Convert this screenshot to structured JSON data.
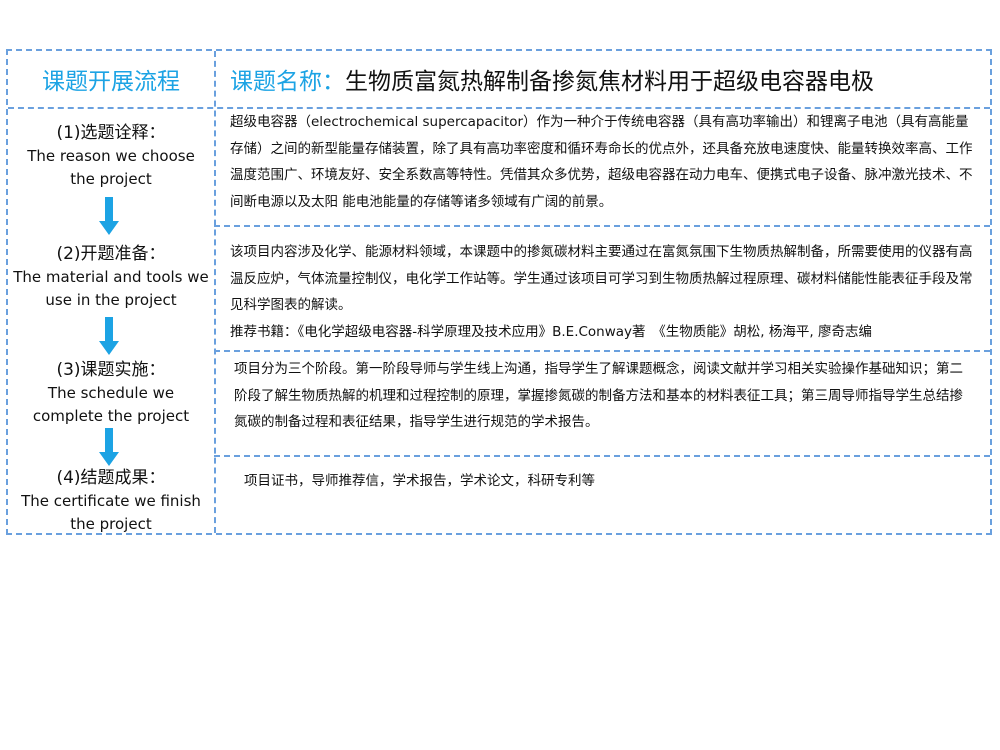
{
  "header": {
    "left_title": "课题开展流程",
    "right_label": "课题名称：",
    "right_title": "生物质富氮热解制备掺氮焦材料用于超级电容器电极"
  },
  "steps": [
    {
      "zh": "(1)选题诠释：",
      "en1": "The reason we choose",
      "en2": "the project"
    },
    {
      "zh": "(2)开题准备：",
      "en1": "The material and tools we",
      "en2": "use in the project"
    },
    {
      "zh": "(3)课题实施：",
      "en1": "The schedule we",
      "en2": "complete the project"
    },
    {
      "zh": "(4)结题成果：",
      "en1": "The certificate we finish",
      "en2": "the project"
    }
  ],
  "arrow_color": "#1ca3e4",
  "content": {
    "c1": "超级电容器（electrochemical supercapacitor）作为一种介于传统电容器（具有高功率输出）和锂离子电池（具有高能量存储）之间的新型能量存储装置，除了具有高功率密度和循环寿命长的优点外，还具备充放电速度快、能量转换效率高、工作温度范围广、环境友好、安全系数高等特性。凭借其众多优势，超级电容器在动力电车、便携式电子设备、脉冲激光技术、不间断电源以及太阳 能电池能量的存储等诸多领域有广阔的前景。",
    "c2": "该项目内容涉及化学、能源材料领域，本课题中的掺氮碳材料主要通过在富氮氛围下生物质热解制备，所需要使用的仪器有高温反应炉，气体流量控制仪，电化学工作站等。学生通过该项目可学习到生物质热解过程原理、碳材料储能性能表征手段及常见科学图表的解读。",
    "c2_books": "推荐书籍：《电化学超级电容器-科学原理及技术应用》B.E.Conway著　《生物质能》胡松, 杨海平, 廖奇志编",
    "c3": "项目分为三个阶段。第一阶段导师与学生线上沟通，指导学生了解课题概念，阅读文献并学习相关实验操作基础知识；第二阶段了解生物质热解的机理和过程控制的原理，掌握掺氮碳的制备方法和基本的材料表征工具；第三周导师指导学生总结掺氮碳的制备过程和表征结果，指导学生进行规范的学术报告。",
    "c4": "项目证书，导师推荐信，学术报告，学术论文，科研专利等"
  }
}
